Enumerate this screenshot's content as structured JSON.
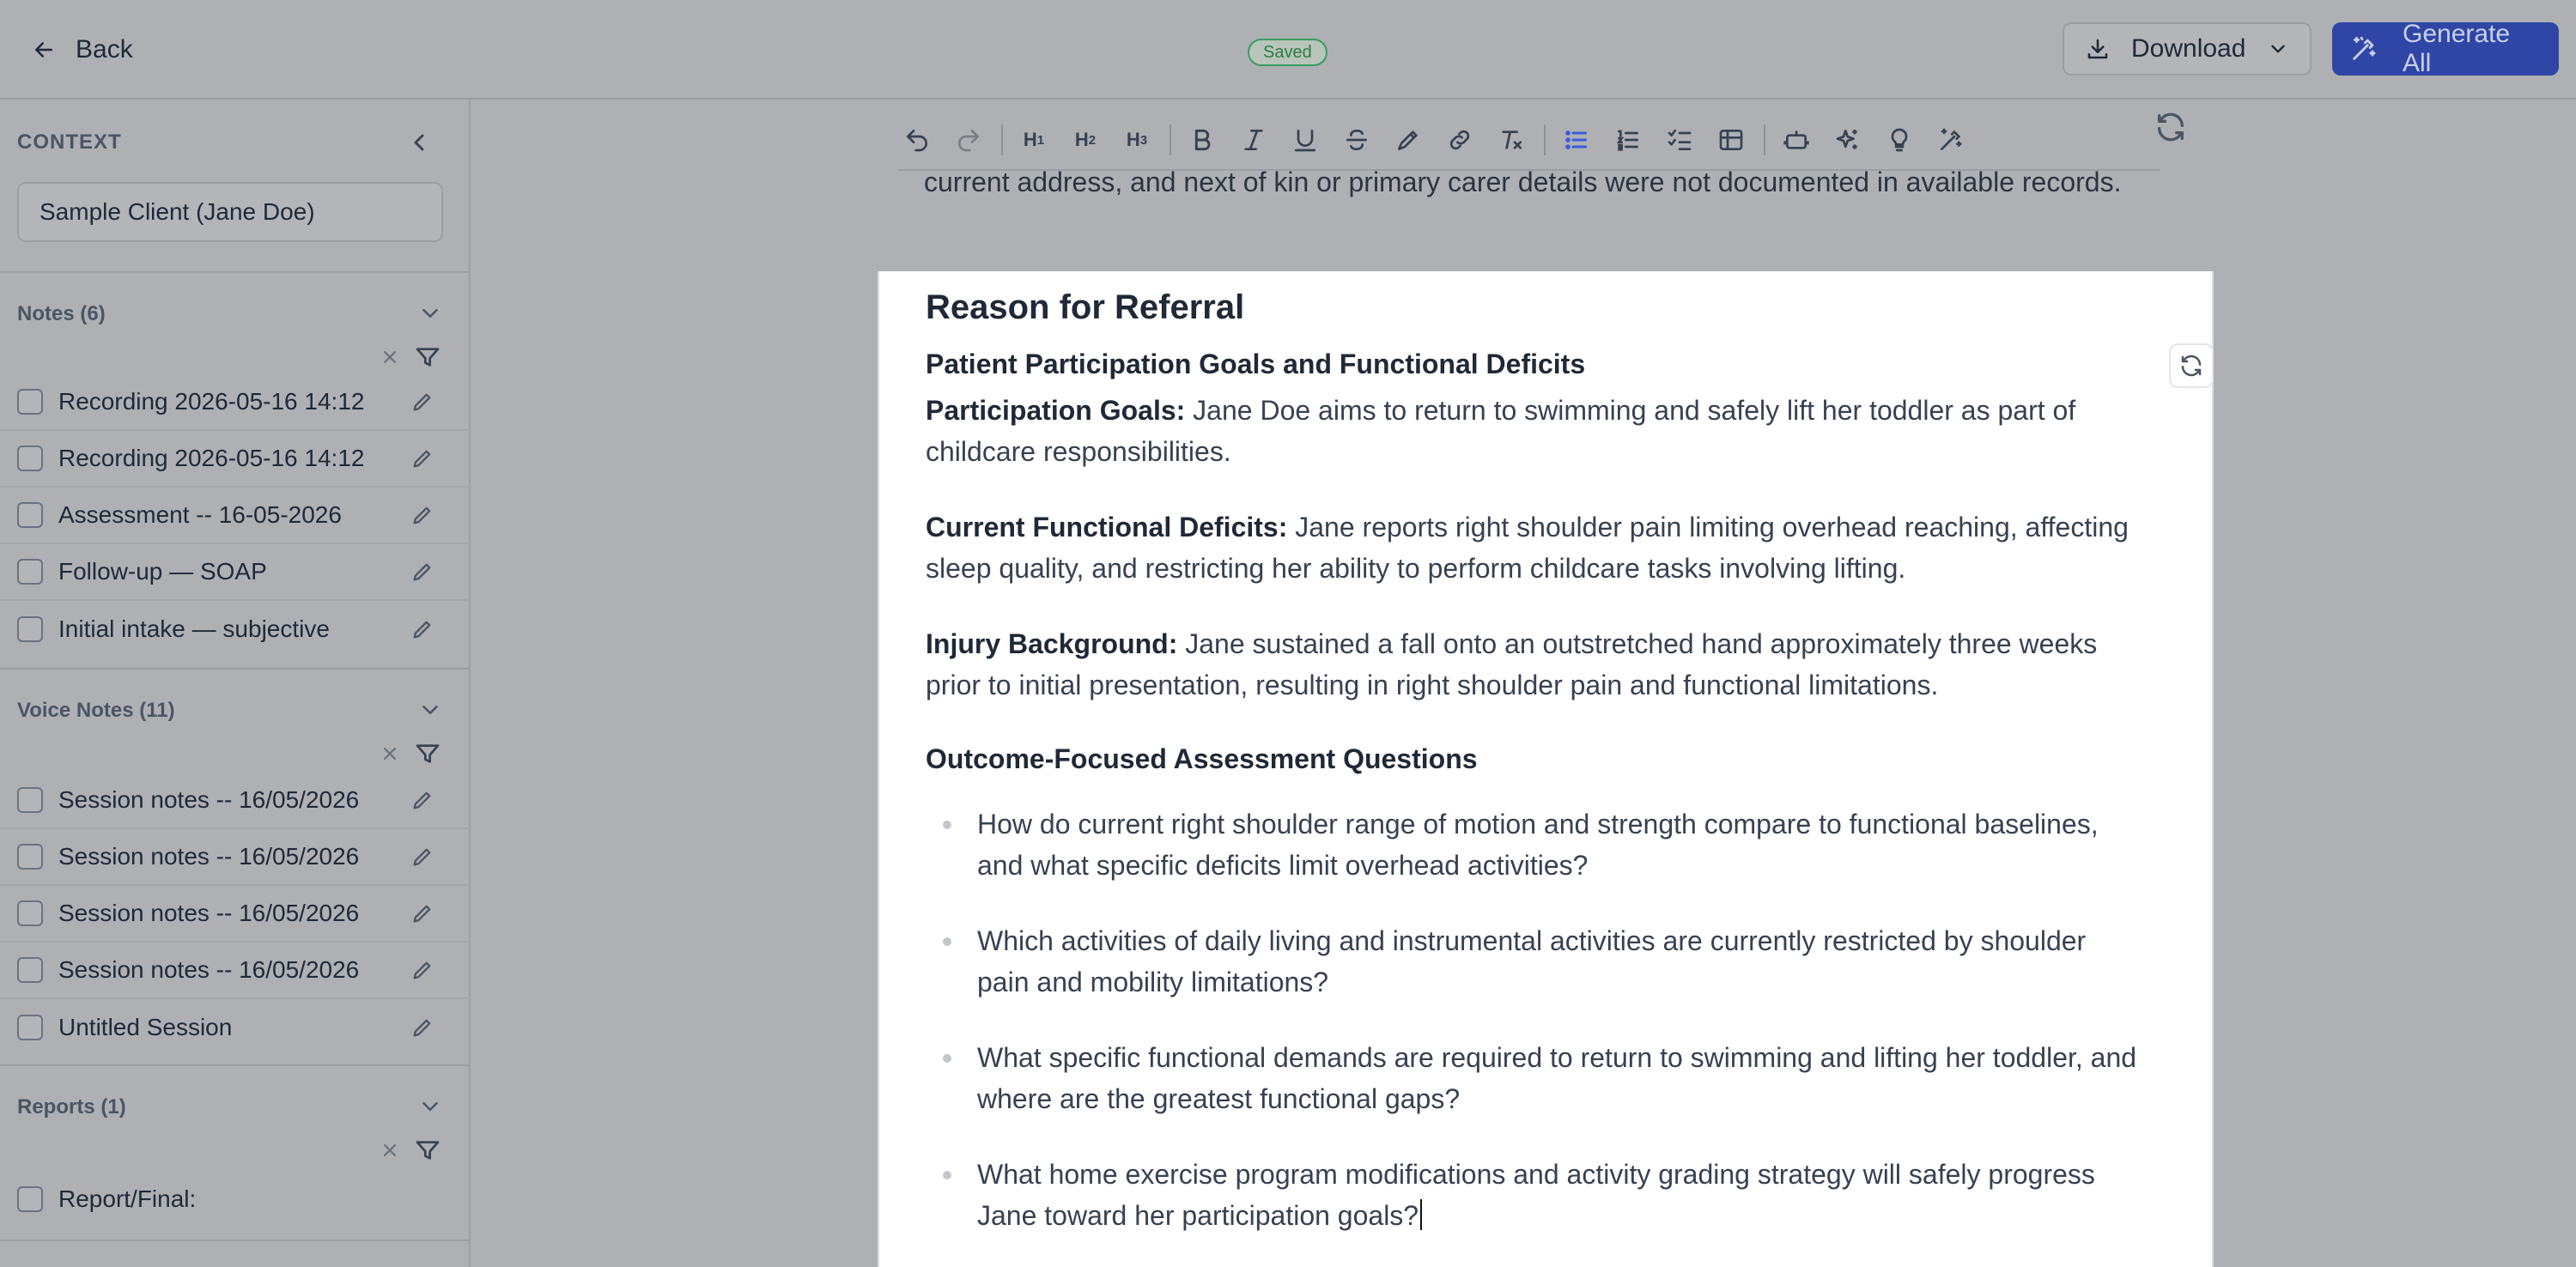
{
  "header": {
    "back_label": "Back",
    "status_badge": "Saved",
    "download_label": "Download",
    "generate_label": "Generate All"
  },
  "sidebar": {
    "context_label": "CONTEXT",
    "client_value": "Sample Client (Jane Doe)",
    "notes": {
      "title": "Notes (6)",
      "items": [
        "Recording 2026-05-16 14:12",
        "Recording 2026-05-16 14:12",
        "Assessment -- 16-05-2026",
        "Follow-up — SOAP",
        "Initial intake — subjective"
      ]
    },
    "voice_notes": {
      "title": "Voice Notes (11)",
      "items": [
        "Session notes -- 16/05/2026",
        "Session notes -- 16/05/2026",
        "Session notes -- 16/05/2026",
        "Session notes -- 16/05/2026",
        "Untitled Session"
      ]
    },
    "reports": {
      "title": "Reports (1)",
      "items": [
        "Report/Final:"
      ]
    }
  },
  "toolbar": {
    "h1": "H",
    "h1_sub": "1",
    "h2": "H",
    "h2_sub": "2",
    "h3": "H",
    "h3_sub": "3",
    "active_tool": "bullet-list"
  },
  "editor": {
    "previous_text": "current address, and next of kin or primary carer details were not documented in available records.",
    "heading": "Reason for Referral",
    "subheading_1": "Patient Participation Goals and Functional Deficits",
    "paragraphs": [
      {
        "label": "Participation Goals:",
        "text": " Jane Doe aims to return to swimming and safely lift her toddler as part of childcare responsibilities."
      },
      {
        "label": "Current Functional Deficits:",
        "text": " Jane reports right shoulder pain limiting overhead reaching, affecting sleep quality, and restricting her ability to perform childcare tasks involving lifting."
      },
      {
        "label": "Injury Background:",
        "text": " Jane sustained a fall onto an outstretched hand approximately three weeks prior to initial presentation, resulting in right shoulder pain and functional limitations."
      }
    ],
    "subheading_2": "Outcome-Focused Assessment Questions",
    "bullets": [
      "How do current right shoulder range of motion and strength compare to functional baselines, and what specific deficits limit overhead activities?",
      "Which activities of daily living and instrumental activities are currently restricted by shoulder pain and mobility limitations?",
      "What specific functional demands are required to return to swimming and lifting her toddler, and where are the greatest functional gaps?",
      "What home exercise program modifications and activity grading strategy will safely progress Jane toward her participation goals?"
    ]
  },
  "colors": {
    "accent": "#2f46a6",
    "active_tool": "#3b5bdb",
    "saved_green": "#2c7a4b",
    "overlay_gray": "#aeb0b4"
  }
}
